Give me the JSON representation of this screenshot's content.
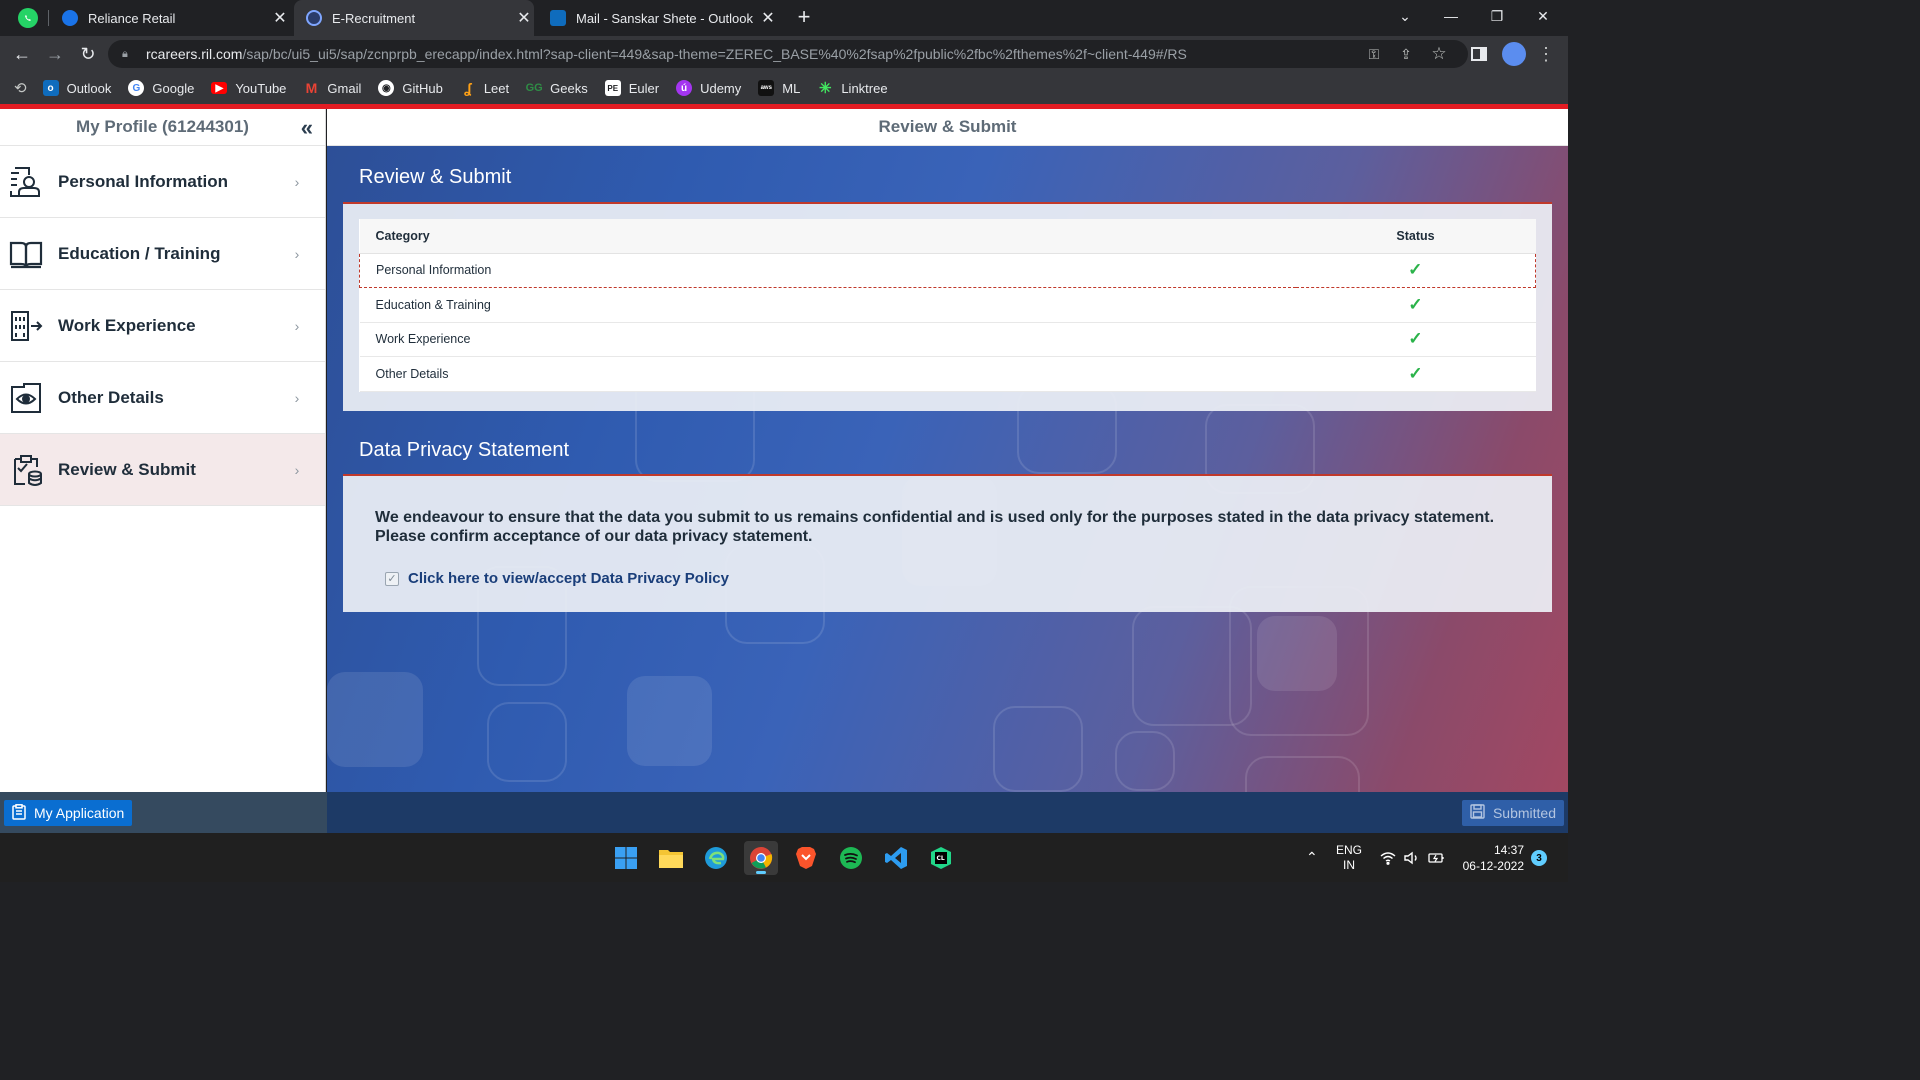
{
  "browser": {
    "tabs": [
      {
        "title": "Reliance Retail",
        "active": false
      },
      {
        "title": "E-Recruitment",
        "active": true
      },
      {
        "title": "Mail - Sanskar Shete - Outlook",
        "active": false
      }
    ],
    "url_host": "rcareers.ril.com",
    "url_path": "/sap/bc/ui5_ui5/sap/zcnprpb_erecapp/index.html?sap-client=449&sap-theme=ZEREC_BASE%40%2fsap%2fpublic%2fbc%2fthemes%2f~client-449#/RS",
    "bookmarks": [
      "Outlook",
      "Google",
      "YouTube",
      "Gmail",
      "GitHub",
      "Leet",
      "Geeks",
      "Euler",
      "Udemy",
      "ML",
      "Linktree"
    ]
  },
  "sidebar": {
    "header": "My Profile (61244301)",
    "items": [
      {
        "label": "Personal Information",
        "icon": "profile-card-icon"
      },
      {
        "label": "Education / Training",
        "icon": "book-icon"
      },
      {
        "label": "Work Experience",
        "icon": "building-icon"
      },
      {
        "label": "Other Details",
        "icon": "folder-eye-icon"
      },
      {
        "label": "Review & Submit",
        "icon": "clipboard-check-icon",
        "selected": true
      }
    ]
  },
  "content": {
    "header": "Review & Submit",
    "review_title": "Review & Submit",
    "table": {
      "col_category": "Category",
      "col_status": "Status",
      "rows": [
        {
          "category": "Personal Information",
          "status": "✓"
        },
        {
          "category": "Education & Training",
          "status": "✓"
        },
        {
          "category": "Work Experience",
          "status": "✓"
        },
        {
          "category": "Other Details",
          "status": "✓"
        }
      ]
    },
    "privacy_title": "Data Privacy Statement",
    "privacy_text": "We endeavour to ensure that the data you submit to us remains confidential and is used only for the purposes stated in the data privacy statement. Please confirm acceptance of our data privacy statement.",
    "privacy_link": "Click here to view/accept Data Privacy Policy",
    "privacy_checked": true
  },
  "footer": {
    "my_application": "My Application",
    "submitted": "Submitted"
  },
  "taskbar": {
    "lang_line1": "ENG",
    "lang_line2": "IN",
    "time": "14:37",
    "date": "06-12-2022",
    "notifications": "3"
  },
  "colors": {
    "accent_red": "#e31c23",
    "sap_blue": "#0a6ed1",
    "check_green": "#2bb34a"
  }
}
